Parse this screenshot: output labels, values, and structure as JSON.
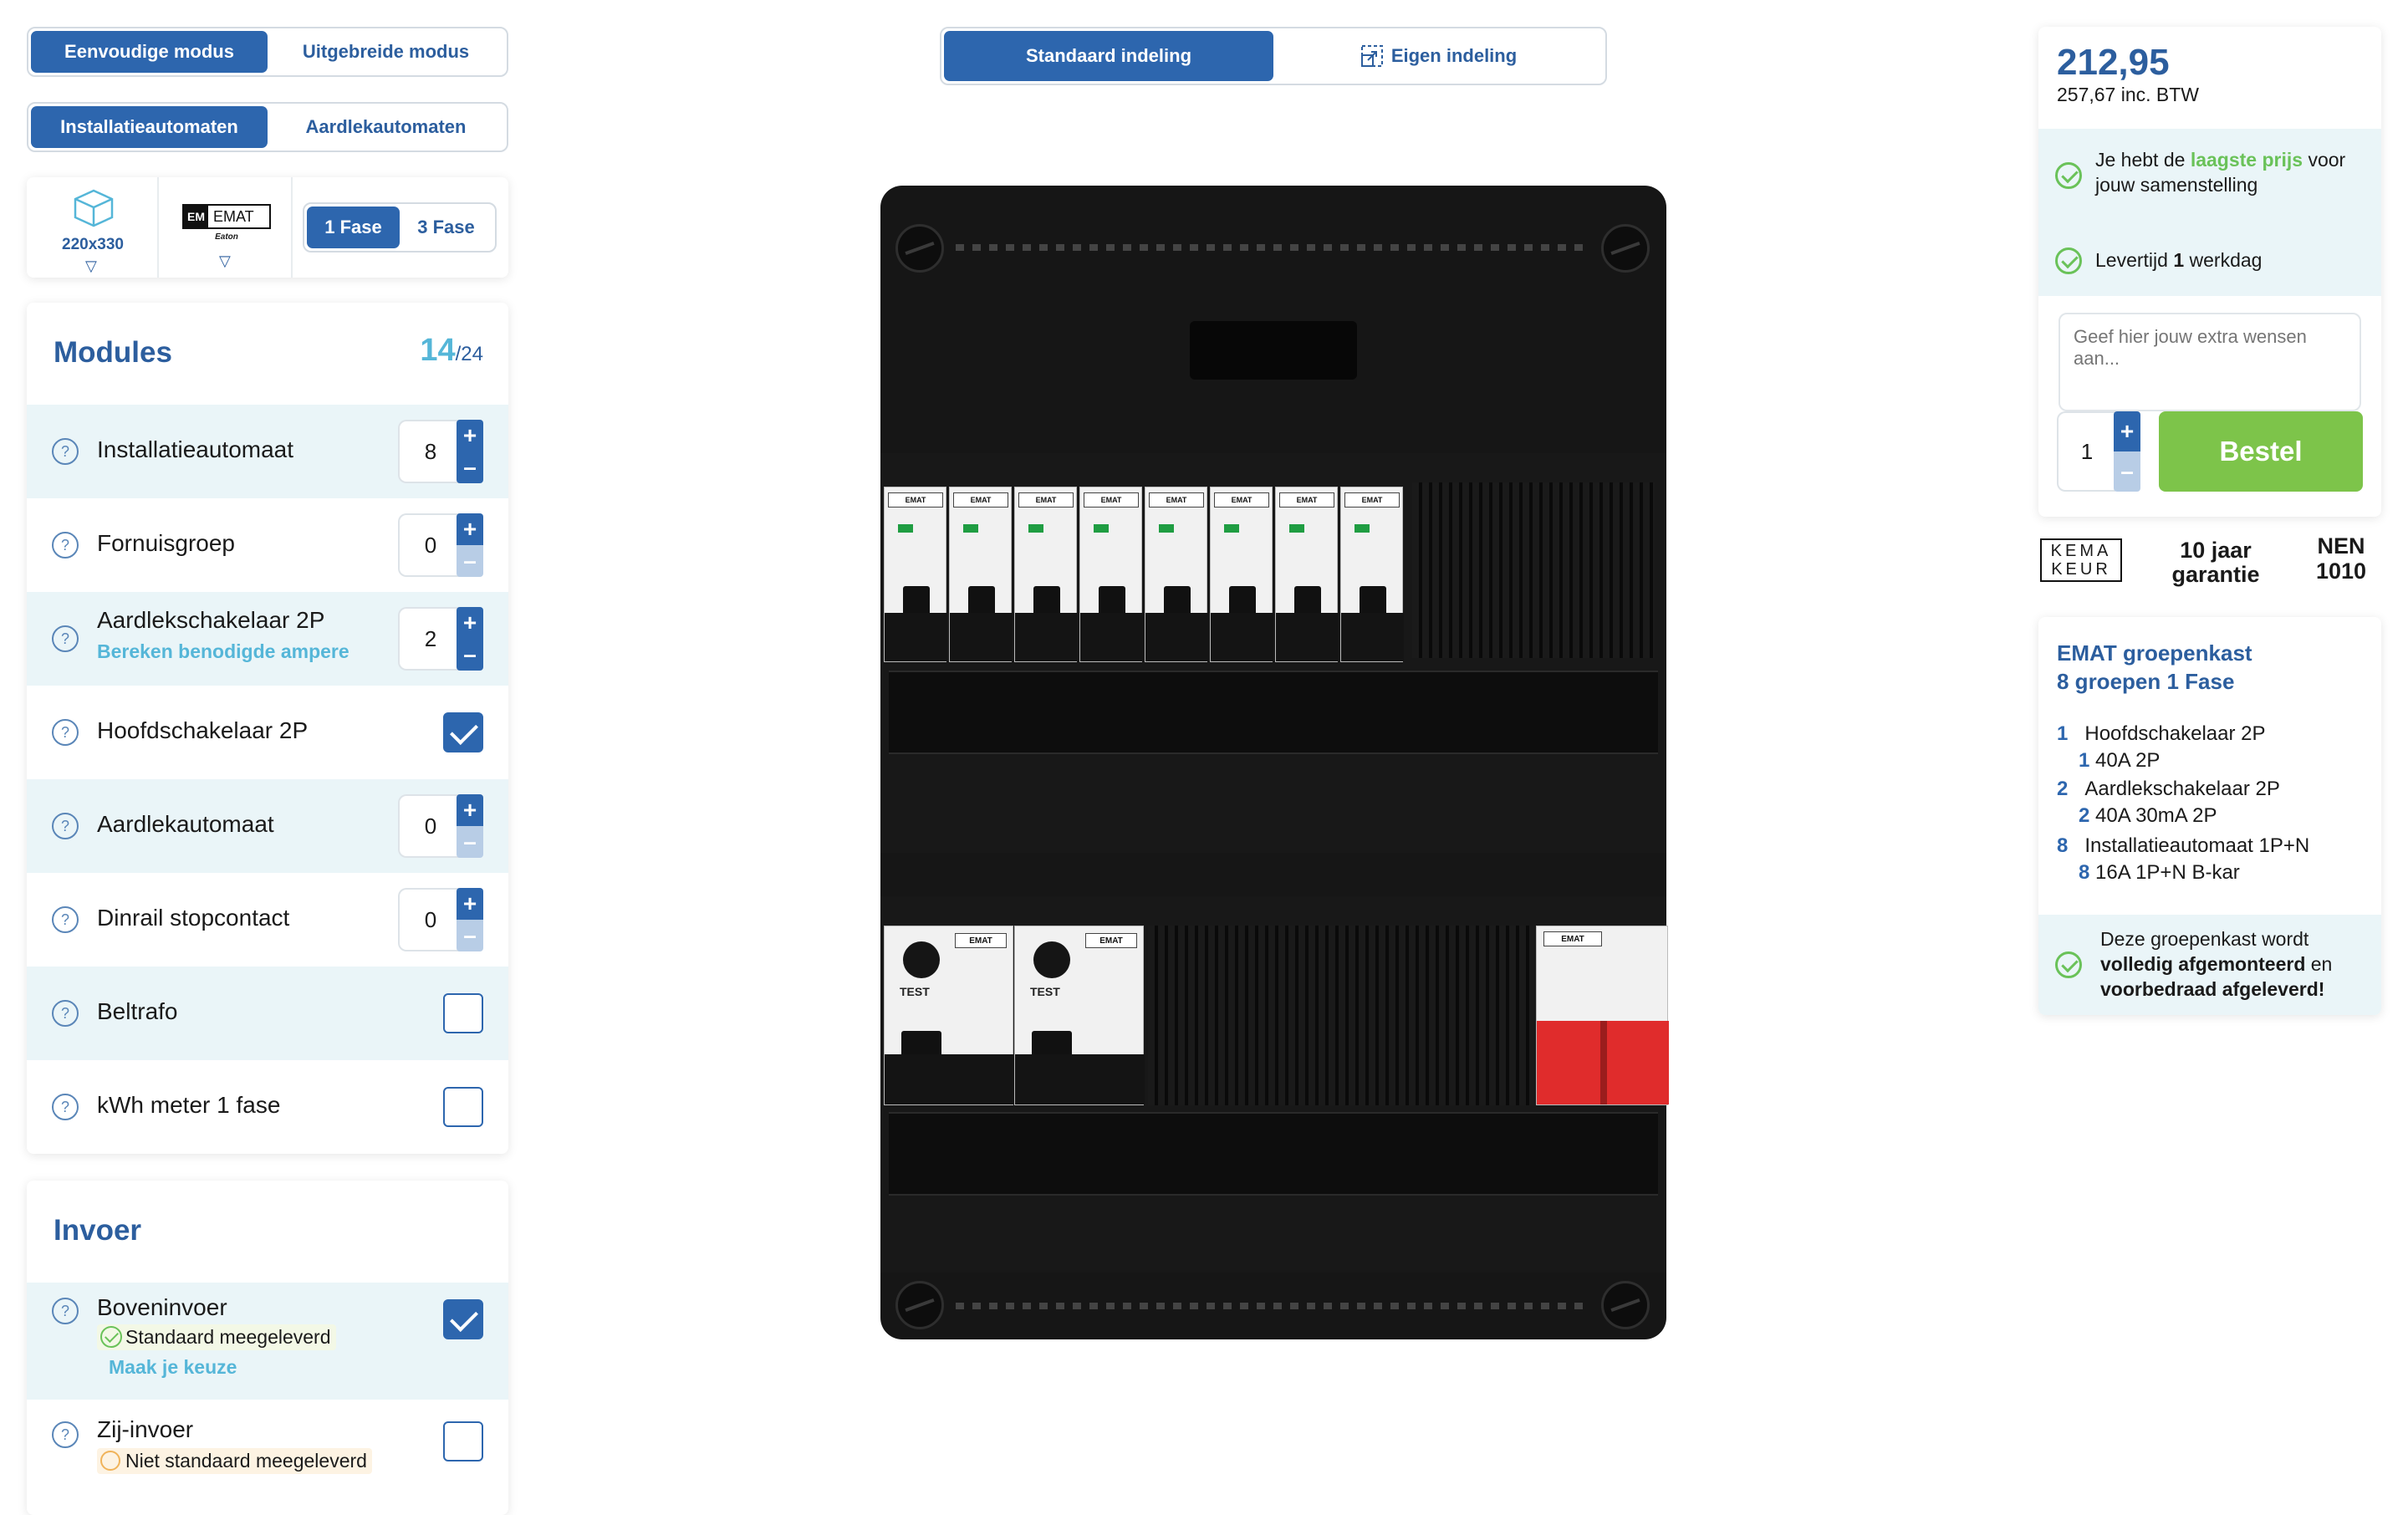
{
  "mode_toggle": {
    "simple": "Eenvoudige modus",
    "advanced": "Uitgebreide modus"
  },
  "type_toggle": {
    "installation": "Installatieautomaten",
    "earth_leak": "Aardlekautomaten"
  },
  "config": {
    "size": "220x330",
    "brand_logo": "EMAT",
    "brand_sub": "Eaton",
    "phase_1": "1 Fase",
    "phase_3": "3 Fase"
  },
  "layout_toggle": {
    "standard": "Standaard indeling",
    "custom": "Eigen indeling"
  },
  "modules": {
    "title": "Modules",
    "count_used": "14",
    "count_total": "/24",
    "items": [
      {
        "label": "Installatieautomaat",
        "value": "8"
      },
      {
        "label": "Fornuisgroep",
        "value": "0"
      },
      {
        "label": "Aardlekschakelaar 2P",
        "sub": "Bereken benodigde ampere",
        "value": "2"
      },
      {
        "label": "Hoofdschakelaar 2P"
      },
      {
        "label": "Aardlekautomaat",
        "value": "0"
      },
      {
        "label": "Dinrail stopcontact",
        "value": "0"
      },
      {
        "label": "Beltrafo"
      },
      {
        "label": "kWh meter 1 fase"
      }
    ]
  },
  "invoer": {
    "title": "Invoer",
    "top": {
      "label": "Boveninvoer",
      "note": "Standaard meegeleverd",
      "link": "Maak je keuze"
    },
    "side": {
      "label": "Zij-invoer",
      "note": "Niet standaard meegeleverd"
    }
  },
  "panel": {
    "mcb_label": "EMAT",
    "rcd_label": "EMAT",
    "rcd_test": "TEST",
    "main_label": "EMAT"
  },
  "price": {
    "amount": "212,95",
    "incl": "257,67 inc. BTW",
    "lowest_pre": "Je hebt de",
    "lowest_hl": "laagste prijs",
    "lowest_post": "voor",
    "lowest_line2": "jouw samenstelling",
    "delivery_pre": "Levertijd",
    "delivery_num": "1",
    "delivery_post": "werkdag",
    "wishes_placeholder": "Geef hier jouw extra wensen aan...",
    "qty": "1",
    "order": "Bestel"
  },
  "badges": {
    "kema_top": "KEMA",
    "kema_bottom": "KEUR",
    "warranty_1": "10 jaar",
    "warranty_2": "garantie",
    "nen_1": "NEN",
    "nen_2": "1010"
  },
  "summary": {
    "title_1": "EMAT groepenkast",
    "title_2": "8 groepen 1 Fase",
    "rows": [
      {
        "num": "1",
        "text": "Hoofdschakelaar 2P"
      },
      {
        "num": "1",
        "text": "40A 2P"
      },
      {
        "num": "2",
        "text": "Aardlekschakelaar 2P"
      },
      {
        "num": "2",
        "text": "40A 30mA 2P"
      },
      {
        "num": "8",
        "text": "Installatieautomaat 1P+N"
      },
      {
        "num": "8",
        "text": "16A 1P+N B-kar"
      }
    ],
    "footer_1": "Deze groepenkast wordt",
    "footer_2a": "volledig afgemonteerd",
    "footer_2b": "en",
    "footer_3": "voorbedraad afgeleverd!"
  },
  "colors": {
    "primary": "#2d66ae",
    "accent": "#6ac259",
    "light_row": "#eaf5f8",
    "link": "#55b6d8"
  }
}
